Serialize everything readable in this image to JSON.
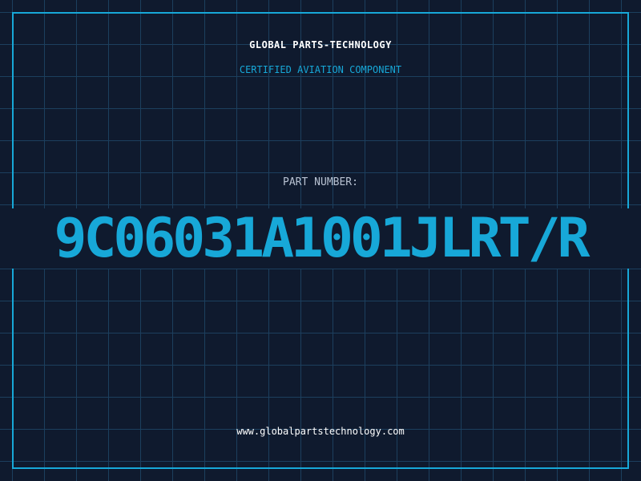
{
  "header": {
    "company_name": "GLOBAL PARTS-TECHNOLOGY",
    "subtitle": "CERTIFIED AVIATION COMPONENT"
  },
  "part": {
    "label": "PART NUMBER:",
    "number": "9C06031A1001JLRT/R"
  },
  "footer": {
    "website": "www.globalpartstechnology.com"
  },
  "colors": {
    "background": "#0f1a2e",
    "grid": "#1c3f5e",
    "accent": "#17a8d8",
    "heading": "#ffffff",
    "label": "#b8c2d2"
  }
}
